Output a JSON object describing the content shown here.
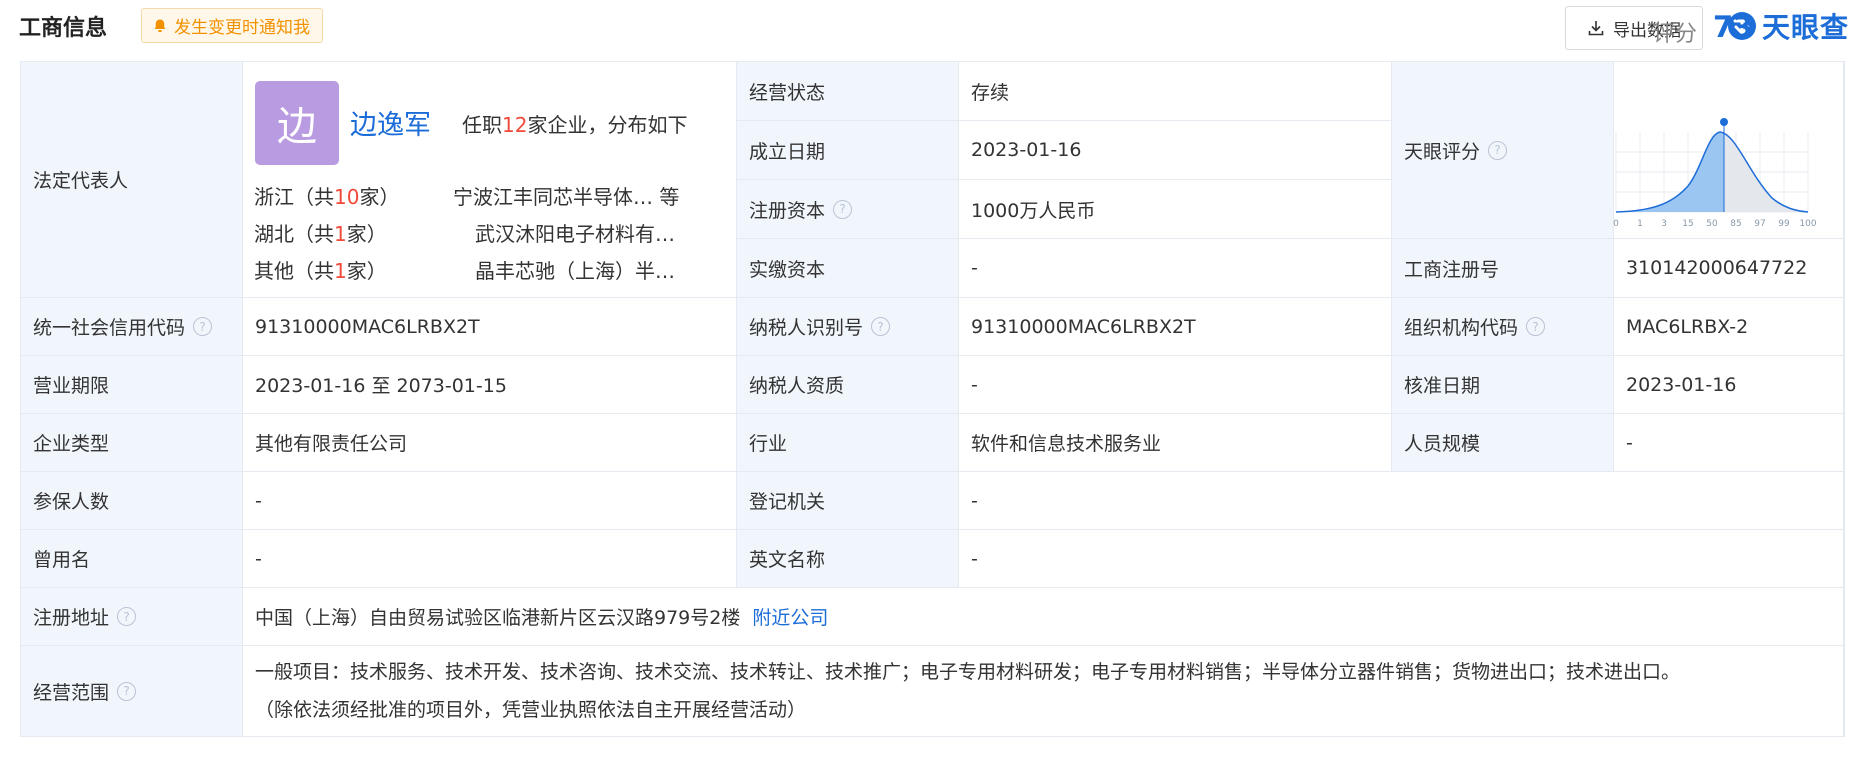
{
  "header": {
    "title": "工商信息",
    "notify_label": "发生变更时通知我",
    "export_label": "导出数据",
    "logo_text": "天眼查"
  },
  "legal_rep": {
    "label": "法定代表人",
    "avatar_char": "边",
    "name": "边逸军",
    "summary_prefix": "任职",
    "summary_count": "12",
    "summary_suffix": "家企业，分布如下",
    "distribution": [
      {
        "region_prefix": "浙江（共",
        "count": "10",
        "region_suffix": "家）",
        "company": "宁波江丰同芯半导体…  等"
      },
      {
        "region_prefix": "湖北（共",
        "count": "1",
        "region_suffix": "家）",
        "company": "武汉沐阳电子材料有…"
      },
      {
        "region_prefix": "其他（共",
        "count": "1",
        "region_suffix": "家）",
        "company": "晶丰芯驰（上海）半…"
      }
    ]
  },
  "fields": {
    "status_label": "经营状态",
    "status_value": "存续",
    "found_label": "成立日期",
    "found_value": "2023-01-16",
    "capital_label": "注册资本",
    "capital_value": "1000万人民币",
    "paid_label": "实缴资本",
    "paid_value": "-",
    "score_label": "天眼评分",
    "reg_no_label": "工商注册号",
    "reg_no_value": "310142000647722",
    "credit_label": "统一社会信用代码",
    "credit_value": "91310000MAC6LRBX2T",
    "taxid_label": "纳税人识别号",
    "taxid_value": "91310000MAC6LRBX2T",
    "org_label": "组织机构代码",
    "org_value": "MAC6LRBX-2",
    "term_label": "营业期限",
    "term_value": "2023-01-16 至 2073-01-15",
    "taxqual_label": "纳税人资质",
    "taxqual_value": "-",
    "approve_label": "核准日期",
    "approve_value": "2023-01-16",
    "type_label": "企业类型",
    "type_value": "其他有限责任公司",
    "industry_label": "行业",
    "industry_value": "软件和信息技术服务业",
    "staff_label": "人员规模",
    "staff_value": "-",
    "insured_label": "参保人数",
    "insured_value": "-",
    "authority_label": "登记机关",
    "authority_value": "-",
    "former_label": "曾用名",
    "former_value": "-",
    "english_label": "英文名称",
    "english_value": "-",
    "address_label": "注册地址",
    "address_value": "中国（上海）自由贸易试验区临港新片区云汉路979号2楼",
    "nearby_label": "附近公司",
    "scope_label": "经营范围",
    "scope_line1": "一般项目：技术服务、技术开发、技术咨询、技术交流、技术转让、技术推广；电子专用材料研发；电子专用材料销售；半导体分立器件销售；货物进出口；技术进出口。",
    "scope_line2": "（除依法须经批准的项目外，凭营业执照依法自主开展经营活动）"
  },
  "score": {
    "label": "评分",
    "value": "73",
    "ticks": [
      "0",
      "1",
      "3",
      "15",
      "50",
      "85",
      "97",
      "99",
      "100"
    ],
    "colors": {
      "accent": "#1d6dd8",
      "curve_fill": "#9cc6f2",
      "grey_fill": "#e4e7ec"
    }
  },
  "colors": {
    "label_bg": "#f1f6fc",
    "border": "#e5e9f0",
    "link": "#1d6dd8",
    "highlight": "#f04b3a",
    "notify": "#f29100"
  }
}
